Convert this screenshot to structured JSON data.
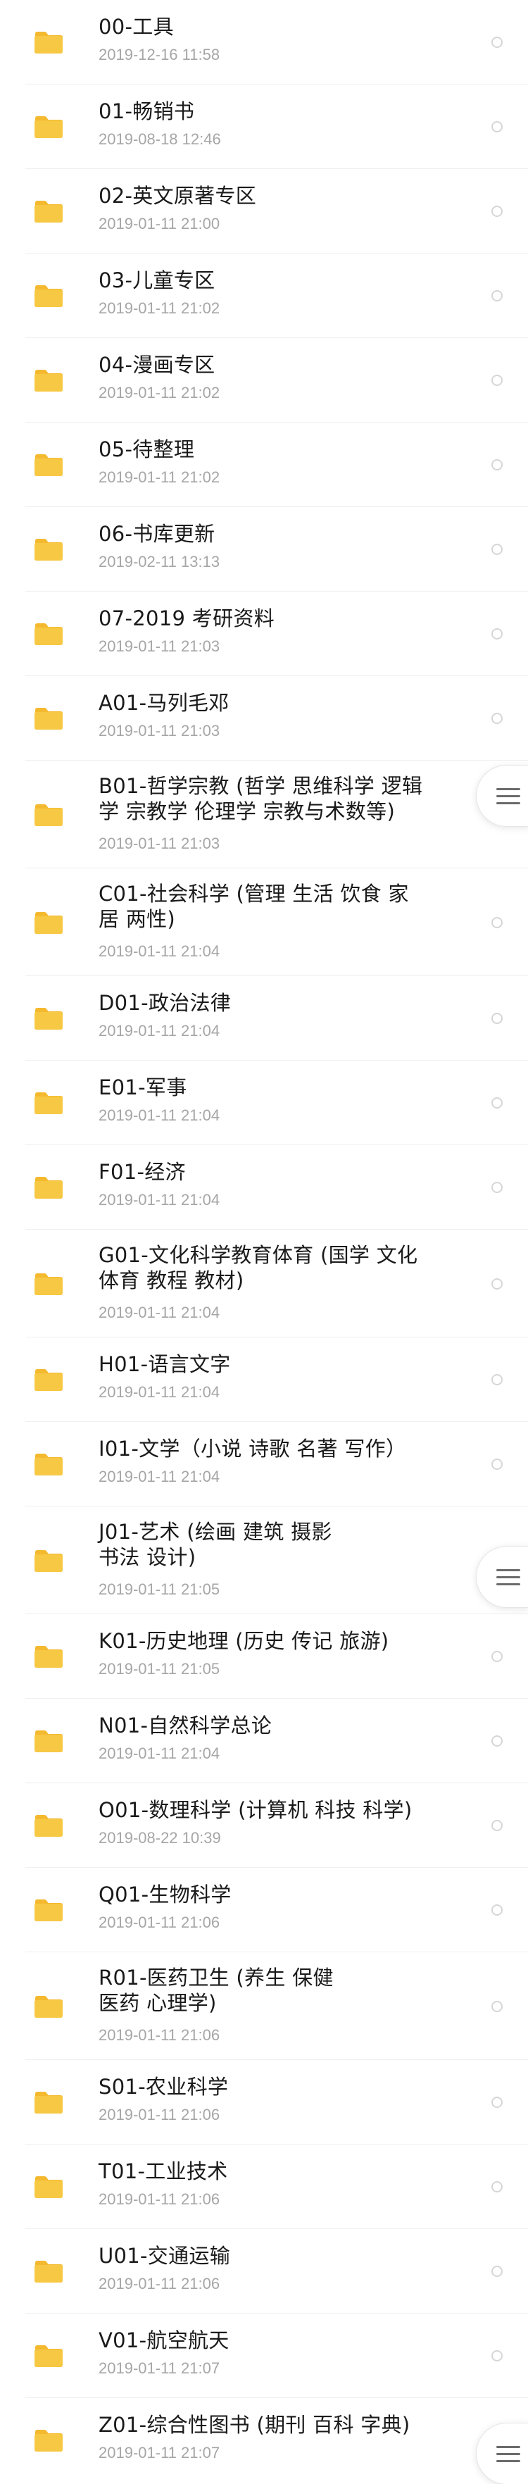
{
  "accent": {
    "folder_color": "#F7C844",
    "folder_tab_color": "#F4B92E",
    "name_color": "#1a1a1a",
    "date_color": "#a6a6a6"
  },
  "icons": {
    "folder": "folder-icon",
    "radio": "radio-unselected-icon",
    "menu": "hamburger-menu-icon"
  },
  "files": [
    {
      "name": "00-工具",
      "date": "2019-12-16 11:58"
    },
    {
      "name": "01-畅销书",
      "date": "2019-08-18 12:46"
    },
    {
      "name": "02-英文原著专区",
      "date": "2019-01-11 21:00"
    },
    {
      "name": "03-儿童专区",
      "date": "2019-01-11 21:02"
    },
    {
      "name": "04-漫画专区",
      "date": "2019-01-11 21:02"
    },
    {
      "name": "05-待整理",
      "date": "2019-01-11 21:02"
    },
    {
      "name": "06-书库更新",
      "date": "2019-02-11 13:13"
    },
    {
      "name": "07-2019 考研资料",
      "date": "2019-01-11 21:03"
    },
    {
      "name": "A01-马列毛邓",
      "date": "2019-01-11 21:03"
    },
    {
      "name": "B01-哲学宗教 (哲学 思维科学 逻辑\n学 宗教学 伦理学 宗教与术数等)",
      "date": "2019-01-11 21:03"
    },
    {
      "name": "C01-社会科学 (管理 生活 饮食 家\n居 两性)",
      "date": "2019-01-11 21:04"
    },
    {
      "name": "D01-政治法律",
      "date": "2019-01-11 21:04"
    },
    {
      "name": "E01-军事",
      "date": "2019-01-11 21:04"
    },
    {
      "name": "F01-经济",
      "date": "2019-01-11 21:04"
    },
    {
      "name": "G01-文化科学教育体育 (国学 文化\n体育 教程 教材)",
      "date": "2019-01-11 21:04"
    },
    {
      "name": "H01-语言文字",
      "date": "2019-01-11 21:04"
    },
    {
      "name": "I01-文学（小说 诗歌 名著 写作）",
      "date": "2019-01-11 21:04"
    },
    {
      "name": "J01-艺术 (绘画 建筑 摄影\n书法 设计)",
      "date": "2019-01-11 21:05"
    },
    {
      "name": "K01-历史地理 (历史 传记 旅游)",
      "date": "2019-01-11 21:05"
    },
    {
      "name": "N01-自然科学总论",
      "date": "2019-01-11 21:04"
    },
    {
      "name": "O01-数理科学 (计算机 科技 科学)",
      "date": "2019-08-22 10:39"
    },
    {
      "name": "Q01-生物科学",
      "date": "2019-01-11 21:06"
    },
    {
      "name": "R01-医药卫生 (养生 保健\n医药 心理学)",
      "date": "2019-01-11 21:06"
    },
    {
      "name": "S01-农业科学",
      "date": "2019-01-11 21:06"
    },
    {
      "name": "T01-工业技术",
      "date": "2019-01-11 21:06"
    },
    {
      "name": "U01-交通运输",
      "date": "2019-01-11 21:06"
    },
    {
      "name": "V01-航空航天",
      "date": "2019-01-11 21:07"
    },
    {
      "name": "Z01-综合性图书 (期刊 百科 字典)",
      "date": "2019-01-11 21:07"
    }
  ]
}
